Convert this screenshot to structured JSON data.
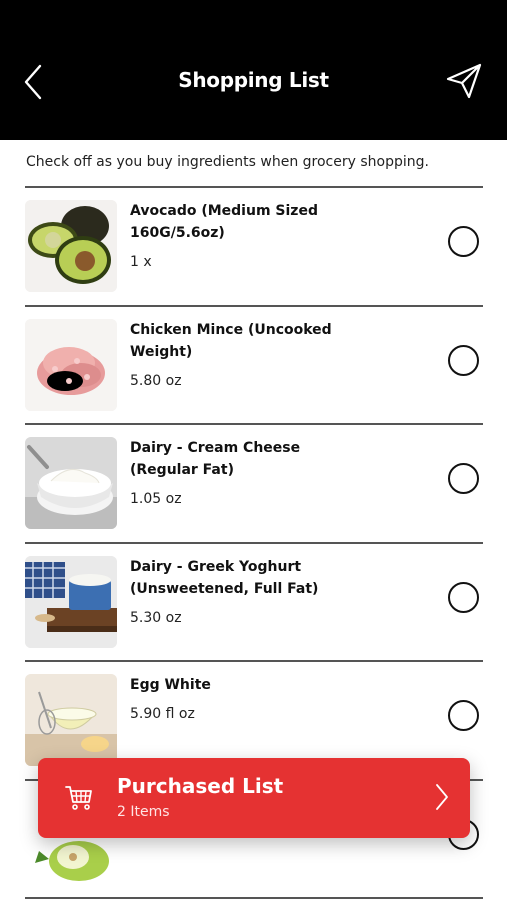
{
  "header": {
    "title": "Shopping List"
  },
  "subtitle": "Check off as you buy ingredients when grocery shopping.",
  "items": [
    {
      "name": "Avocado (Medium Sized 160G/5.6oz)",
      "qty": "1 x",
      "icon": "avocado-image"
    },
    {
      "name": "Chicken Mince (Uncooked Weight)",
      "qty": "5.80 oz",
      "icon": "chicken-mince-image"
    },
    {
      "name": "Dairy - Cream Cheese (Regular Fat)",
      "qty": "1.05 oz",
      "icon": "cream-cheese-image"
    },
    {
      "name": "Dairy - Greek Yoghurt (Unsweetened, Full Fat)",
      "qty": "5.30 oz",
      "icon": "greek-yoghurt-image"
    },
    {
      "name": "Egg White",
      "qty": "5.90 fl oz",
      "icon": "egg-white-image"
    },
    {
      "name": "",
      "qty": "",
      "icon": "pear-image"
    }
  ],
  "purchased": {
    "title": "Purchased List",
    "count": "2 Items"
  },
  "colors": {
    "header_bg": "#000000",
    "accent": "#e53232"
  }
}
